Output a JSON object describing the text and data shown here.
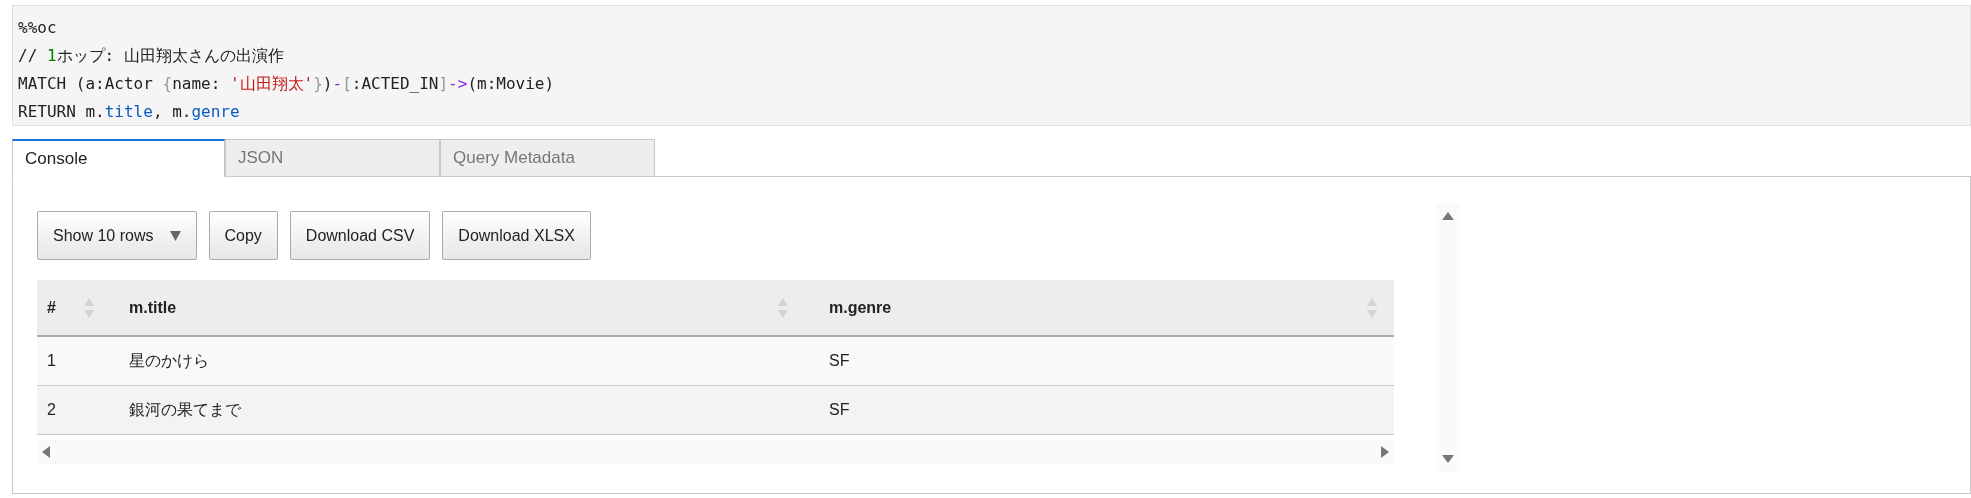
{
  "code_lines": [
    [
      {
        "kind": "plain",
        "text": "%%oc"
      }
    ],
    [
      {
        "kind": "plain",
        "text": "// "
      },
      {
        "kind": "number",
        "text": "1"
      },
      {
        "kind": "plain",
        "text": "ホップ: 山田翔太さんの出演作"
      }
    ],
    [
      {
        "kind": "plain",
        "text": "MATCH (a:Actor "
      },
      {
        "kind": "bracket",
        "text": "{"
      },
      {
        "kind": "plain",
        "text": "name: "
      },
      {
        "kind": "string",
        "text": "'山田翔太'"
      },
      {
        "kind": "bracket",
        "text": "}"
      },
      {
        "kind": "plain",
        "text": ")"
      },
      {
        "kind": "operator",
        "text": "-"
      },
      {
        "kind": "bracket",
        "text": "["
      },
      {
        "kind": "plain",
        "text": ":ACTED_IN"
      },
      {
        "kind": "bracket",
        "text": "]"
      },
      {
        "kind": "operator",
        "text": "->"
      },
      {
        "kind": "plain",
        "text": "(m:Movie)"
      }
    ],
    [
      {
        "kind": "plain",
        "text": "RETURN m."
      },
      {
        "kind": "property",
        "text": "title"
      },
      {
        "kind": "plain",
        "text": ", m."
      },
      {
        "kind": "property",
        "text": "genre"
      }
    ]
  ],
  "tabs": [
    {
      "label": "Console",
      "selected": true
    },
    {
      "label": "JSON",
      "selected": false
    },
    {
      "label": "Query Metadata",
      "selected": false
    }
  ],
  "buttons": [
    {
      "label": "Show 10 rows",
      "kind": "dropdown"
    },
    {
      "label": "Copy",
      "kind": "button"
    },
    {
      "label": "Download CSV",
      "kind": "button"
    },
    {
      "label": "Download XLSX",
      "kind": "button"
    }
  ],
  "table": {
    "columns": [
      "#",
      "m.title",
      "m.genre"
    ],
    "rows": [
      [
        "1",
        "星のかけら",
        "SF"
      ],
      [
        "2",
        "銀河の果てまで",
        "SF"
      ]
    ]
  }
}
